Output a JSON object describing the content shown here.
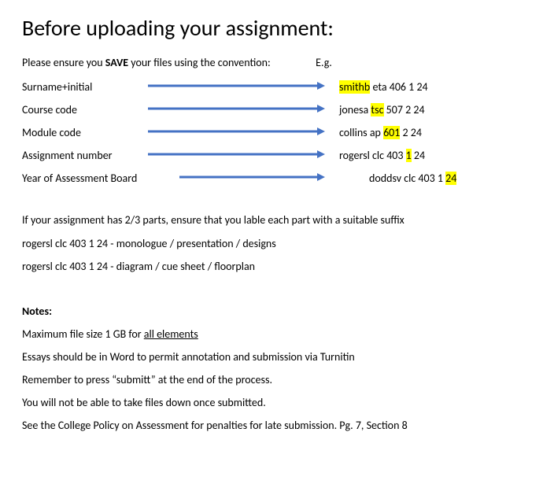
{
  "title": "Before uploading your assignment:",
  "intro_left_pre": "Please ensure you ",
  "intro_left_strong": "SAVE",
  "intro_left_post": " your files using the convention:",
  "intro_right": "E.g.",
  "labels": {
    "surname": "Surname+initial",
    "course": "Course code",
    "module": "Module code",
    "assignment": "Assignment number",
    "year": "Year of Assessment Board"
  },
  "examples": {
    "surname": {
      "pre": "",
      "hl": "smithb",
      "post": " eta 406 1 24"
    },
    "course": {
      "pre": "jonesa ",
      "hl": "tsc",
      "post": " 507 2 24"
    },
    "module": {
      "pre": "collins ap ",
      "hl": "601",
      "post": " 2 24"
    },
    "assignment": {
      "pre": "rogersl clc 403 ",
      "hl": "1",
      "post": " 24"
    },
    "year": {
      "pre": "doddsv clc 403 1 ",
      "hl": "24",
      "post": ""
    }
  },
  "parts_intro": "If your assignment has 2/3 parts, ensure that you lable each part with a suitable suffix",
  "part_example_1": "rogersl clc 403 1 24  - monologue / presentation / designs",
  "part_example_2": "rogersl clc 403 1 24  - diagram / cue sheet / floorplan",
  "notes_heading": "Notes:",
  "note1_pre": "Maximum file size 1 GB for ",
  "note1_ul": "all elements",
  "note2": "Essays should be in Word to permit annotation and submission via Turnitin",
  "note3": "Remember to press “submitt” at the end of the process.",
  "note4": "You will not be able to take files down once submitted.",
  "note5": "See the College Policy on Assessment for penalties for late submission. Pg. 7, Section 8",
  "arrow_color": "#4472C4",
  "arrow_widths": {
    "surname": 225,
    "course": 225,
    "module": 225,
    "assignment": 225,
    "year": 185
  }
}
